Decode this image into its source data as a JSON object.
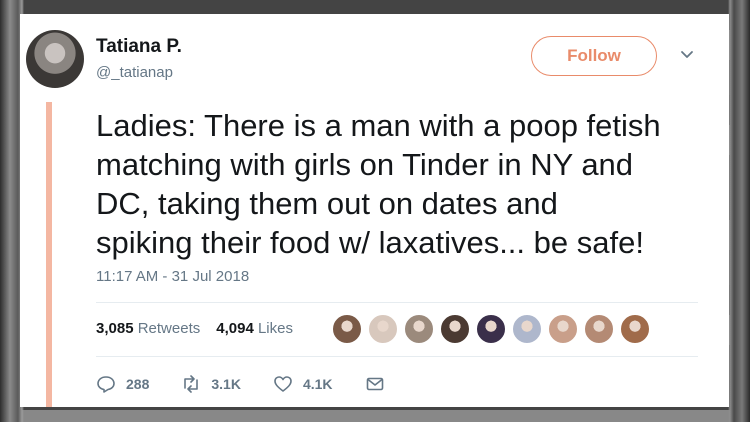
{
  "user": {
    "name": "Tatiana P.",
    "handle": "@_tatianap"
  },
  "follow_label": "Follow",
  "tweet": {
    "lines": [
      "Ladies: There is a man with a poop fetish",
      "matching with girls on Tinder in NY and",
      "DC, taking them out on dates and",
      "spiking their food w/ laxatives... be safe!"
    ],
    "timestamp": "11:17 AM - 31 Jul 2018"
  },
  "stats": {
    "retweets": "3,085",
    "retweets_label": "Retweets",
    "likes": "4,094",
    "likes_label": "Likes"
  },
  "actions": {
    "replies": "288",
    "retweets": "3.1K",
    "likes": "4.1K"
  },
  "colors": {
    "accent": "#e98b6a",
    "accent_bar": "#f4b7a2",
    "text": "#14171a",
    "muted": "#657786"
  },
  "likers": [
    "#7a5a47",
    "#d8c8bd",
    "#9b8a7c",
    "#4b3a32",
    "#3a2f4a",
    "#aeb7cc",
    "#c99f8a",
    "#b48a74",
    "#a06b4a"
  ]
}
